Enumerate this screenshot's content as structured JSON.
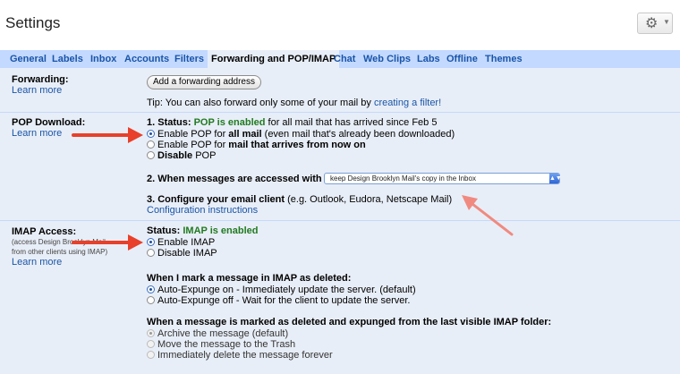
{
  "header": {
    "title": "Settings",
    "gear_icon": "gear-icon",
    "gear_glyph": "⚙",
    "caret_glyph": "▼"
  },
  "tabs": [
    {
      "label": "General"
    },
    {
      "label": "Labels"
    },
    {
      "label": "Inbox"
    },
    {
      "label": "Accounts"
    },
    {
      "label": "Filters"
    },
    {
      "label": "Forwarding and POP/IMAP",
      "active": true
    },
    {
      "label": "Chat"
    },
    {
      "label": "Web Clips"
    },
    {
      "label": "Labs"
    },
    {
      "label": "Offline"
    },
    {
      "label": "Themes"
    }
  ],
  "forwarding": {
    "label": "Forwarding:",
    "learn_more": "Learn more",
    "button": "Add a forwarding address",
    "tip_prefix": "Tip: You can also forward only some of your mail by ",
    "tip_link": "creating a filter!"
  },
  "pop": {
    "label": "POP Download:",
    "learn_more": "Learn more",
    "status_prefix": "1. Status: ",
    "status_value": "POP is enabled",
    "status_suffix": " for all mail that has arrived since Feb 5",
    "options": [
      {
        "pre": "Enable POP for ",
        "bold": "all mail",
        "post": " (even mail that's already been downloaded)",
        "selected": true
      },
      {
        "pre": "Enable POP for ",
        "bold": "mail that arrives from now on",
        "post": "",
        "selected": false
      },
      {
        "pre": "",
        "bold": "Disable",
        "post": " POP",
        "selected": false
      }
    ],
    "access_label": "2. When messages are accessed with POP",
    "access_value": "keep Design Brooklyn Mail's copy in the Inbox",
    "configure_bold": "3. Configure your email client",
    "configure_rest": " (e.g. Outlook, Eudora, Netscape Mail)",
    "configure_link": "Configuration instructions"
  },
  "imap": {
    "label": "IMAP Access:",
    "sub": "(access Design Brooklyn Mail from other clients using IMAP)",
    "learn_more": "Learn more",
    "status_prefix": "Status: ",
    "status_value": "IMAP is enabled",
    "options": [
      {
        "text": "Enable IMAP",
        "selected": true
      },
      {
        "text": "Disable IMAP",
        "selected": false
      }
    ],
    "deleted_heading": "When I mark a message in IMAP as deleted:",
    "deleted_options": [
      {
        "text": "Auto-Expunge on - Immediately update the server. (default)",
        "selected": true
      },
      {
        "text": "Auto-Expunge off - Wait for the client to update the server.",
        "selected": false
      }
    ],
    "expunged_heading": "When a message is marked as deleted and expunged from the last visible IMAP folder:",
    "expunged_options": [
      {
        "text": "Archive the message (default)",
        "selected": true
      },
      {
        "text": "Move the message to the Trash",
        "selected": false
      },
      {
        "text": "Immediately delete the message forever",
        "selected": false
      }
    ]
  },
  "colors": {
    "tab_bar": "#c3d9ff",
    "panel": "#e8eef7",
    "link": "#1a55a8",
    "status_green": "#207a20",
    "arrow": "#e8402a"
  }
}
